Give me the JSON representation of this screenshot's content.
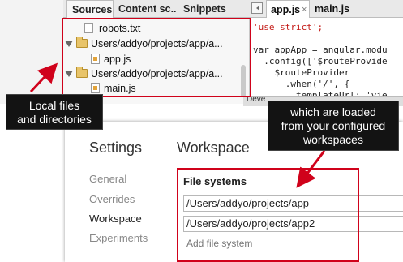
{
  "sources_panel": {
    "tabs": [
      "Sources",
      "Content sc...",
      "Snippets"
    ],
    "tree": [
      {
        "label": "robots.txt",
        "type": "file"
      },
      {
        "label": "Users/addyo/projects/app/a...",
        "type": "folder"
      },
      {
        "label": "app.js",
        "type": "file"
      },
      {
        "label": "Users/addyo/projects/app/a...",
        "type": "folder"
      },
      {
        "label": "main.js",
        "type": "file"
      }
    ]
  },
  "editor": {
    "tabs": [
      "app.js",
      "main.js"
    ],
    "close_glyph": "×",
    "code_lines": [
      [
        "'use strict';"
      ],
      [
        ""
      ],
      [
        "var appApp = angular.modu"
      ],
      [
        "  .config(['$routeProvide"
      ],
      [
        "    $routeProvider"
      ],
      [
        "      .when('/', {"
      ],
      [
        "        templateUrl: 'vie"
      ]
    ],
    "devbar_text": "Deve"
  },
  "callouts": {
    "local": "Local files\nand directories",
    "loaded": "which are loaded\nfrom your configured\nworkspaces"
  },
  "settings": {
    "title": "Settings",
    "section_title": "Workspace",
    "nav": [
      "General",
      "Overrides",
      "Workspace",
      "Experiments"
    ],
    "active_nav": "Workspace",
    "fs_heading": "File systems",
    "file_systems": [
      "/Users/addyo/projects/app",
      "/Users/addyo/projects/app2"
    ],
    "add_label": "Add file system"
  },
  "colors": {
    "accent_red": "#d0021b",
    "callout_bg": "#131313"
  }
}
